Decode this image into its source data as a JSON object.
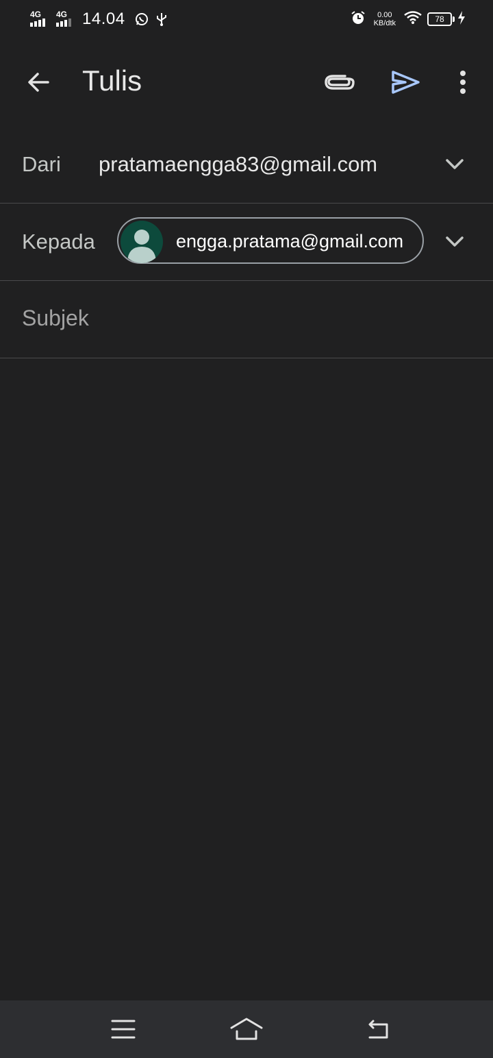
{
  "status_bar": {
    "network1": "4G",
    "network2": "4G",
    "time": "14.04",
    "speed_value": "0.00",
    "speed_unit": "KB/dtk",
    "battery": "78"
  },
  "app_bar": {
    "title": "Tulis",
    "icons": [
      "arrow-back-icon",
      "paperclip-icon",
      "send-icon",
      "more-vert-icon"
    ],
    "send_color": "#a8c7fa"
  },
  "compose": {
    "from_label": "Dari",
    "from_value": "pratamaengga83@gmail.com",
    "to_label": "Kepada",
    "to_chips": [
      {
        "email": "engga.pratama@gmail.com",
        "avatar_color": "#0d4a3c"
      }
    ],
    "subject_placeholder": "Subjek",
    "body_value": ""
  },
  "nav_bar": {
    "icons": [
      "menu-icon",
      "home-icon",
      "back-nav-icon"
    ]
  }
}
